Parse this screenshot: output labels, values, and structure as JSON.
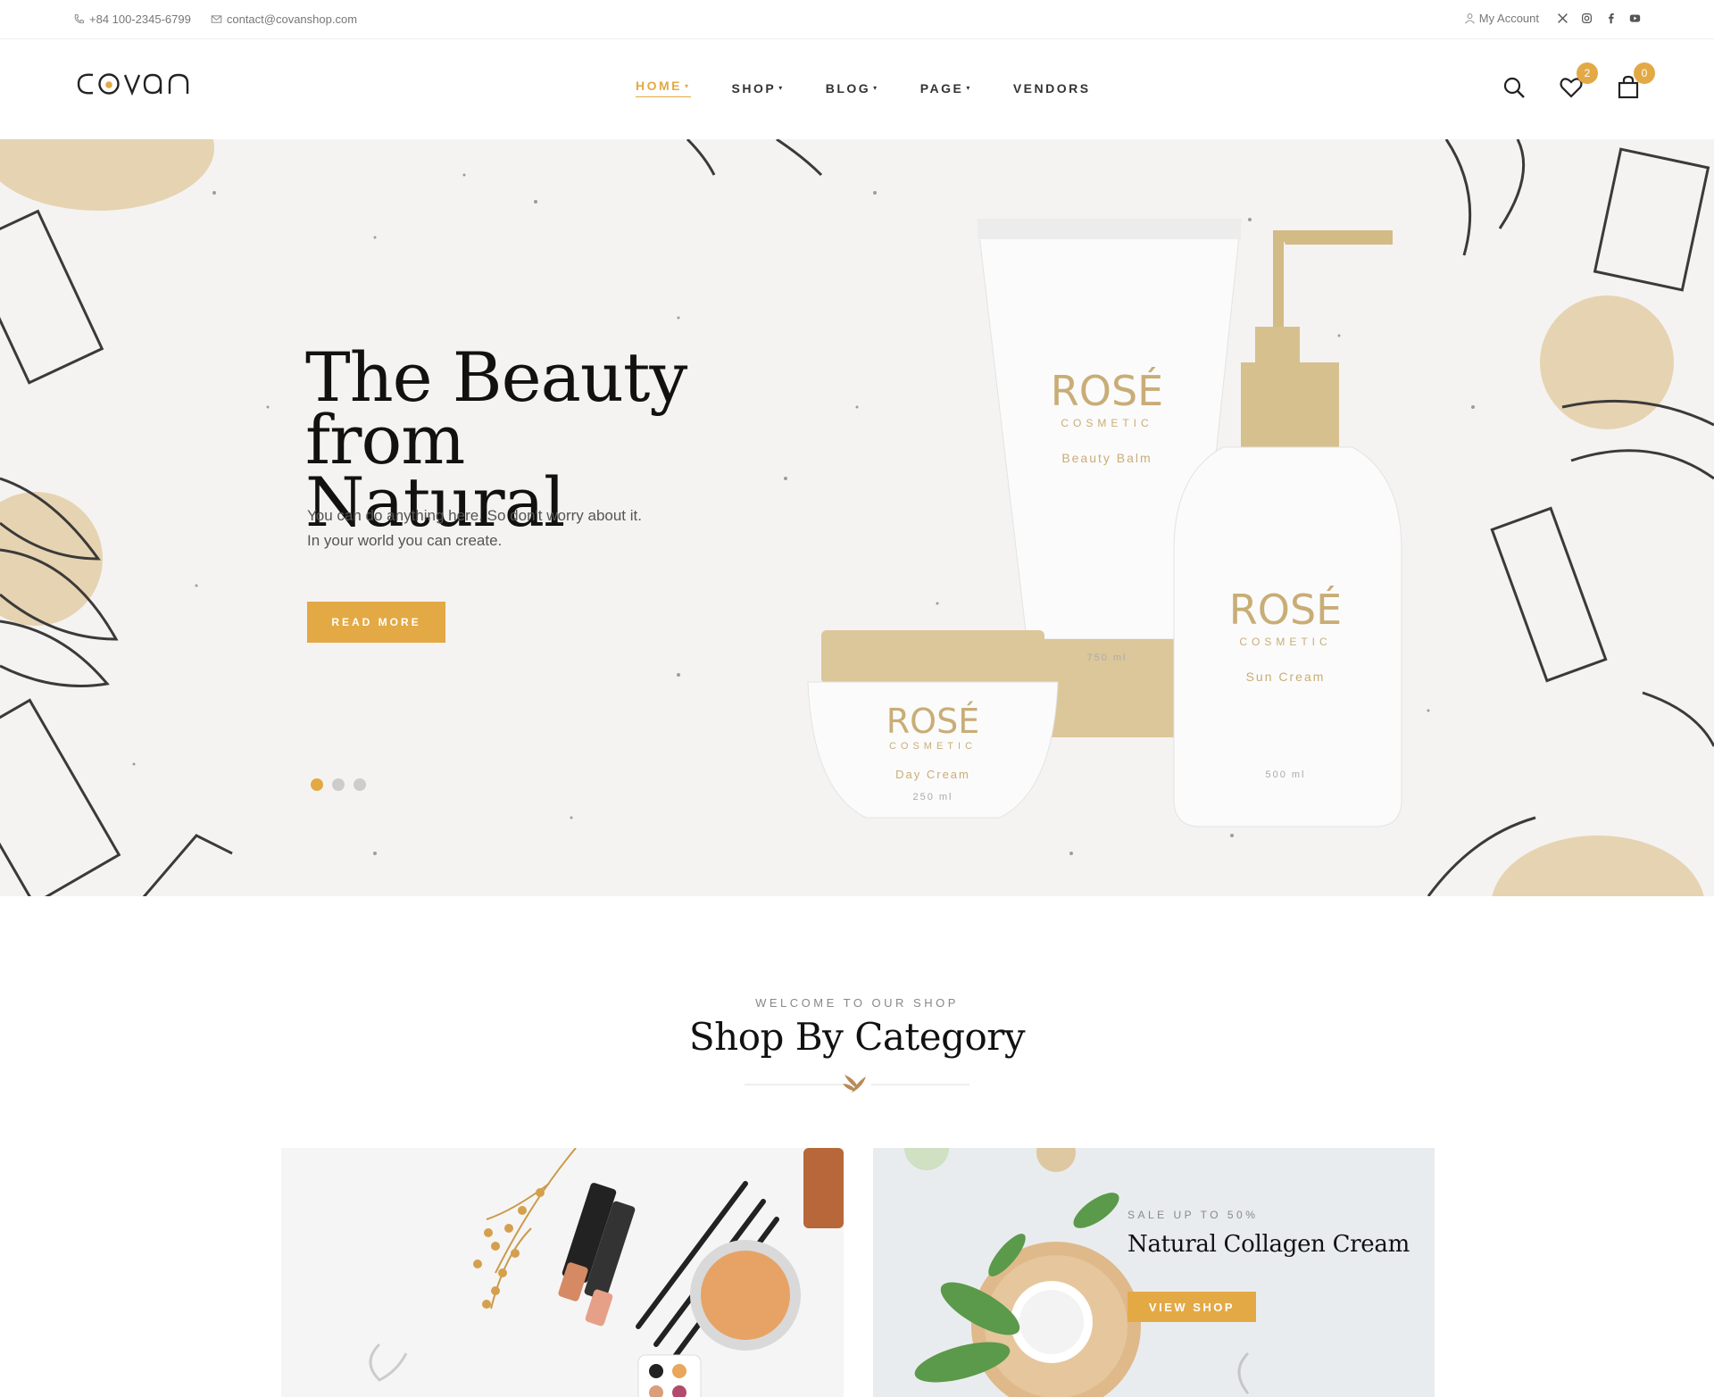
{
  "topbar": {
    "phone": "+84 100-2345-6799",
    "email": "contact@covanshop.com",
    "account_label": "My Account",
    "socials": [
      "x-icon",
      "instagram-icon",
      "facebook-icon",
      "youtube-icon"
    ]
  },
  "header": {
    "logo": "covan",
    "nav": [
      {
        "label": "HOME",
        "active": true
      },
      {
        "label": "SHOP",
        "active": false
      },
      {
        "label": "BLOG",
        "active": false
      },
      {
        "label": "PAGE",
        "active": false
      },
      {
        "label": "VENDORS",
        "active": false
      }
    ],
    "wishlist_count": "2",
    "cart_count": "0"
  },
  "hero": {
    "title_line1": "The Beauty from",
    "title_line2": "Natural",
    "subtitle_line1": "You can do anything here. So don't worry about it.",
    "subtitle_line2": "In your world you can create.",
    "button": "READ MORE",
    "slides": 3,
    "active_slide": 1,
    "products": [
      {
        "brand": "ROSÉ",
        "sub": "COSMETIC",
        "name": "Beauty Balm",
        "size": "750 ml"
      },
      {
        "brand": "ROSÉ",
        "sub": "COSMETIC",
        "name": "Sun Cream",
        "size": "500 ml"
      },
      {
        "brand": "ROSÉ",
        "sub": "COSMETIC",
        "name": "Day Cream",
        "size": "250 ml"
      }
    ]
  },
  "section": {
    "welcome": "WELCOME TO OUR SHOP",
    "title": "Shop By Category"
  },
  "cards": {
    "right": {
      "tag": "SALE UP TO 50%",
      "title": "Natural Collagen Cream",
      "button": "VIEW SHOP"
    }
  },
  "colors": {
    "accent": "#e3a945",
    "hero_bg": "#f4f3f2",
    "text_dark": "#111111"
  }
}
